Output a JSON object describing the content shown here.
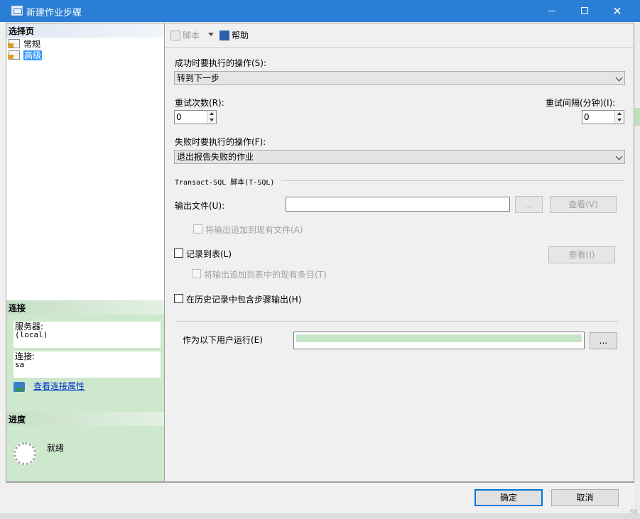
{
  "window": {
    "title": "新建作业步骤"
  },
  "left": {
    "select_page_header": "选择页",
    "pages": [
      {
        "label": "常规",
        "selected": false
      },
      {
        "label": "高级",
        "selected": true
      }
    ],
    "connection_header": "连接",
    "server_label": "服务器:",
    "server_value": "(local)",
    "connection_label": "连接:",
    "connection_value": "sa",
    "view_conn_props_link": "查看连接属性",
    "progress_header": "进度",
    "progress_status": "就绪"
  },
  "toolbar": {
    "script_label": "脚本",
    "help_label": "帮助"
  },
  "form": {
    "on_success_label": "成功时要执行的操作(S):",
    "on_success_value": "转到下一步",
    "retry_attempts_label": "重试次数(R):",
    "retry_attempts_value": "0",
    "retry_interval_label": "重试间隔(分钟)(I):",
    "retry_interval_value": "0",
    "on_failure_label": "失败时要执行的操作(F):",
    "on_failure_value": "退出报告失败的作业",
    "tsql_group_label": "Transact-SQL 脚本(T-SQL)",
    "output_file_label": "输出文件(U):",
    "output_file_value": "",
    "browse_label": "...",
    "view_file_label": "查看(V)",
    "append_output_label": "将输出追加到现有文件(A)",
    "log_to_table_label": "记录到表(L)",
    "view_table_label": "查看(I)",
    "append_table_label": "将输出追加到表中的现有条目(T)",
    "include_history_label": "在历史记录中包含步骤输出(H)",
    "run_as_label": "作为以下用户运行(E)",
    "run_as_value": "",
    "run_as_browse_label": "..."
  },
  "footer": {
    "ok_label": "确定",
    "cancel_label": "取消"
  },
  "colors": {
    "title_bar": "#2b7ed6",
    "selection": "#3399ff",
    "connection_panel": "#cde8cd",
    "link": "#0033cc"
  }
}
